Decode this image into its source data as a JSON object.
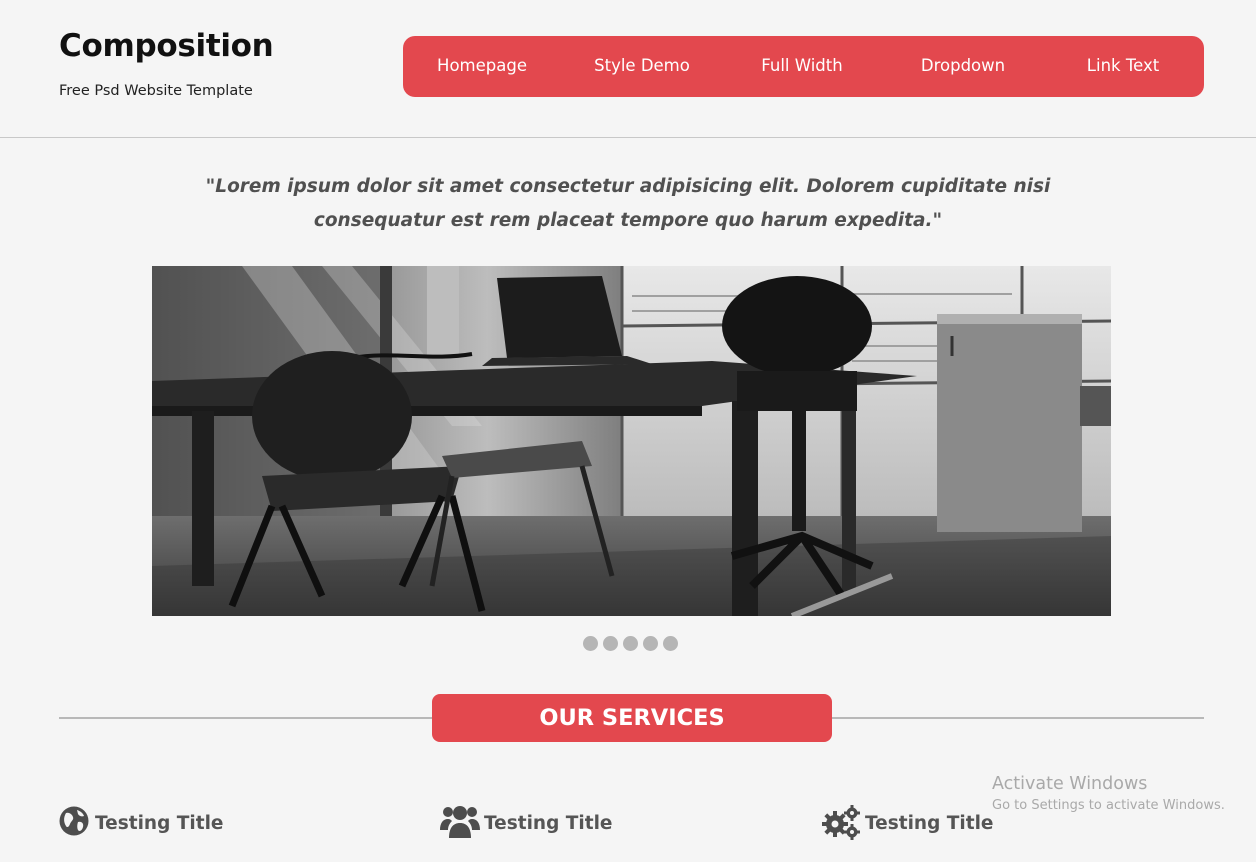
{
  "brand": {
    "title": "Composition",
    "subtitle": "Free Psd Website Template"
  },
  "nav": {
    "items": [
      {
        "label": "Homepage"
      },
      {
        "label": "Style Demo"
      },
      {
        "label": "Full Width"
      },
      {
        "label": "Dropdown"
      },
      {
        "label": "Link Text"
      }
    ]
  },
  "quote": "\"Lorem ipsum dolor sit amet consectetur adipisicing elit. Dolorem cupiditate nisi consequatur est rem placeat tempore quo harum expedita.\"",
  "slider": {
    "image": "office-desk-chairs-photo",
    "dot_count": 5
  },
  "services": {
    "heading": "OUR SERVICES",
    "items": [
      {
        "title": "Testing Title",
        "icon": "globe-icon"
      },
      {
        "title": "Testing Title",
        "icon": "users-icon"
      },
      {
        "title": "Testing Title",
        "icon": "gears-icon"
      }
    ]
  },
  "colors": {
    "accent": "#e3484e",
    "background": "#f5f5f5"
  },
  "os_watermark": {
    "title": "Activate Windows",
    "subtitle": "Go to Settings to activate Windows."
  }
}
